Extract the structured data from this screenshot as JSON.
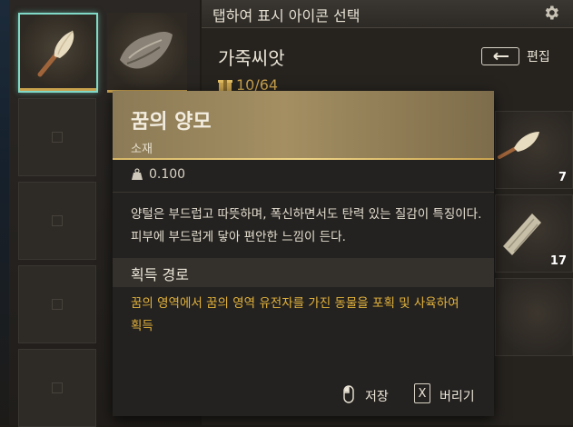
{
  "header": {
    "title": "탭하여 표시 아이콘 선택",
    "settings_icon": "gear-icon"
  },
  "category": {
    "name": "가죽씨앗",
    "count": "10/64",
    "count_icon": "box-icon"
  },
  "edit": {
    "key_icon": "enter-key-icon",
    "label": "편집"
  },
  "inventory_slots": [
    {
      "quantity": "7",
      "icon": "wool-tuft-icon"
    },
    {
      "quantity": "17",
      "icon": "fiber-bundle-icon"
    }
  ],
  "tooltip": {
    "name": "꿈의 양모",
    "type": "소재",
    "weight": "0.100",
    "weight_icon": "weight-icon",
    "description": "양털은 부드럽고 따뜻하며, 폭신하면서도 탄력 있는 질감이 특징이다. 피부에 부드럽게 닿아 편안한 느낌이 든다.",
    "acquisition_title": "획득 경로",
    "acquisition_text": "꿈의 영역에서 꿈의 영역 유전자를 가진 동물을 포획 및 사육하여 획득",
    "actions": {
      "save_label": "저장",
      "save_icon": "mouse-icon",
      "discard_key": "X",
      "discard_label": "버리기"
    }
  },
  "colors": {
    "accent_gold": "#e2b23c",
    "selection": "#7fd9c6",
    "header_gold": "#a48f62"
  }
}
